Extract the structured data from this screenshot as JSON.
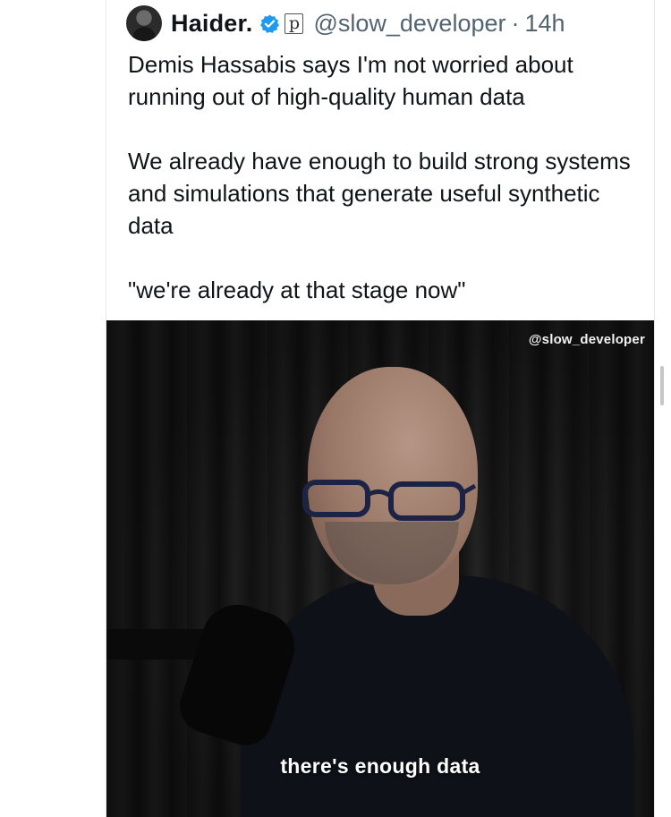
{
  "author": {
    "display_name": "Haider.",
    "handle": "@slow_developer",
    "separator": "·",
    "time_ago": "14h",
    "p_badge": "p"
  },
  "tweet": {
    "paragraphs": [
      "Demis Hassabis says I'm not worried about running out of high-quality human data",
      "We already have enough to build strong systems and simulations that generate useful synthetic data",
      "\"we're already at that stage now\""
    ]
  },
  "media": {
    "watermark": "@slow_developer",
    "caption": "there's enough data"
  },
  "icons": {
    "avatar": "avatar",
    "verified": "verified-badge-icon",
    "p_badge": "p-badge-icon"
  },
  "colors": {
    "verified_blue": "#1d9bf0",
    "secondary_text": "#536471",
    "primary_text": "#0f1419",
    "video_background": "#151515"
  }
}
